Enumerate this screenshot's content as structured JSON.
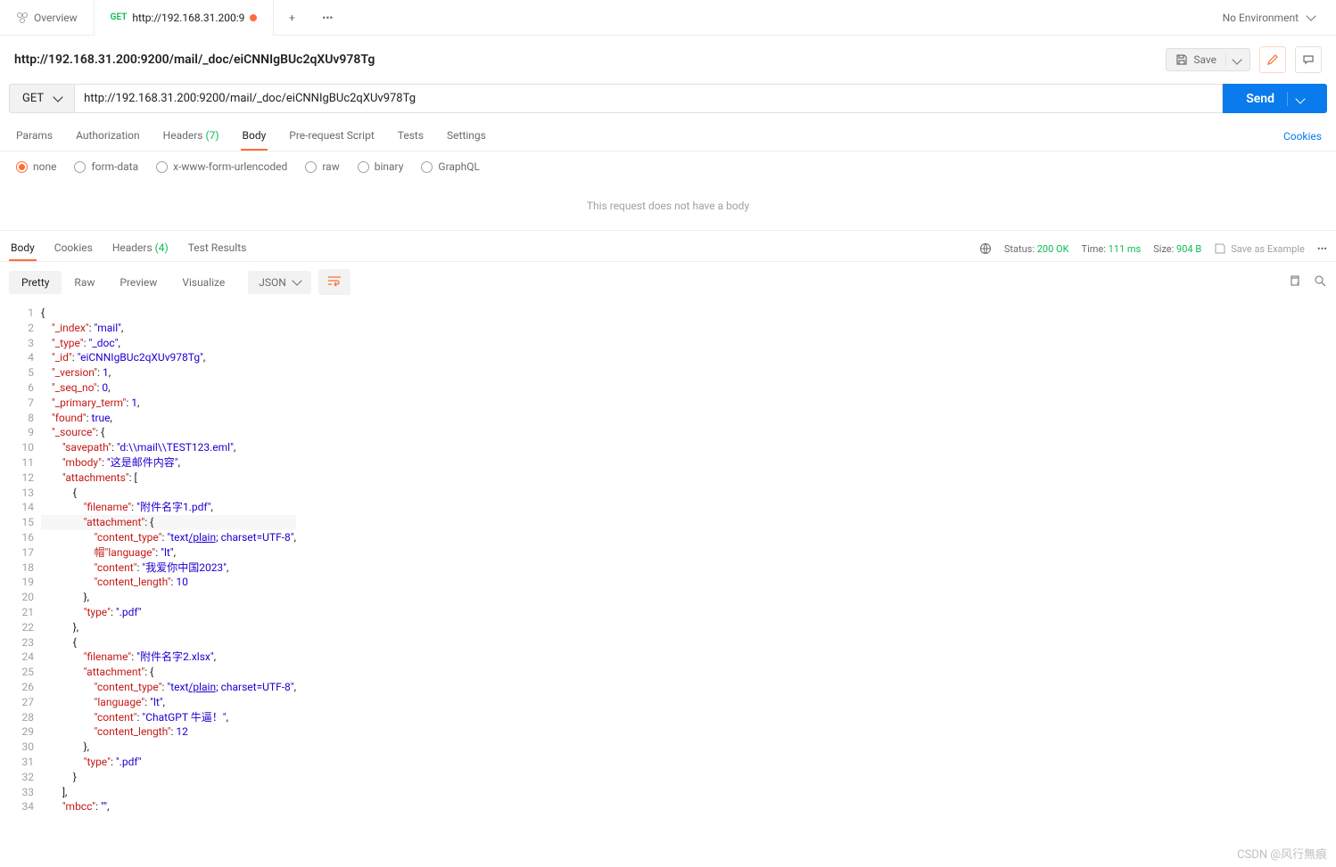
{
  "tabs": {
    "overview": "Overview",
    "request": {
      "method": "GET",
      "title": "http://192.168.31.200:9"
    }
  },
  "env": {
    "label": "No Environment"
  },
  "title": "http://192.168.31.200:9200/mail/_doc/eiCNNIgBUc2qXUv978Tg",
  "save_label": "Save",
  "request": {
    "method": "GET",
    "url": "http://192.168.31.200:9200/mail/_doc/eiCNNIgBUc2qXUv978Tg",
    "send": "Send"
  },
  "reqTabs": {
    "params": "Params",
    "auth": "Authorization",
    "headers": "Headers",
    "headers_count": "(7)",
    "body": "Body",
    "prereq": "Pre-request Script",
    "tests": "Tests",
    "settings": "Settings",
    "cookies": "Cookies"
  },
  "bodyTypes": {
    "none": "none",
    "formdata": "form-data",
    "xwww": "x-www-form-urlencoded",
    "raw": "raw",
    "binary": "binary",
    "graphql": "GraphQL"
  },
  "noBody": "This request does not have a body",
  "respTabs": {
    "body": "Body",
    "cookies": "Cookies",
    "headers": "Headers",
    "headers_count": "(4)",
    "results": "Test Results"
  },
  "status": {
    "label": "Status:",
    "code": "200 OK",
    "timeLabel": "Time:",
    "time": "111 ms",
    "sizeLabel": "Size:",
    "size": "904 B"
  },
  "saveExample": "Save as Example",
  "views": {
    "pretty": "Pretty",
    "raw": "Raw",
    "preview": "Preview",
    "visualize": "Visualize",
    "format": "JSON"
  },
  "json": {
    "_index": "mail",
    "_type": "_doc",
    "_id": "eiCNNIgBUc2qXUv978Tg",
    "_version": 1,
    "_seq_no": 0,
    "_primary_term": 1,
    "found": true,
    "_source": {
      "savepath": "d:\\\\mail\\\\TEST123.eml",
      "mbody": "这是邮件内容",
      "attachments": [
        {
          "filename": "附件名字1.pdf",
          "attachment": {
            "content_type": "text/plain; charset=UTF-8",
            "language": "lt",
            "content": "我爱你中国2023",
            "content_length": 10
          },
          "type": ".pdf"
        },
        {
          "filename": "附件名字2.xlsx",
          "attachment": {
            "content_type": "text/plain; charset=UTF-8",
            "language": "lt",
            "content": "ChatGPT 牛逼！",
            "content_length": 12
          },
          "type": ".pdf"
        }
      ],
      "mbcc": ""
    }
  },
  "watermark": "CSDN @风行無痕"
}
